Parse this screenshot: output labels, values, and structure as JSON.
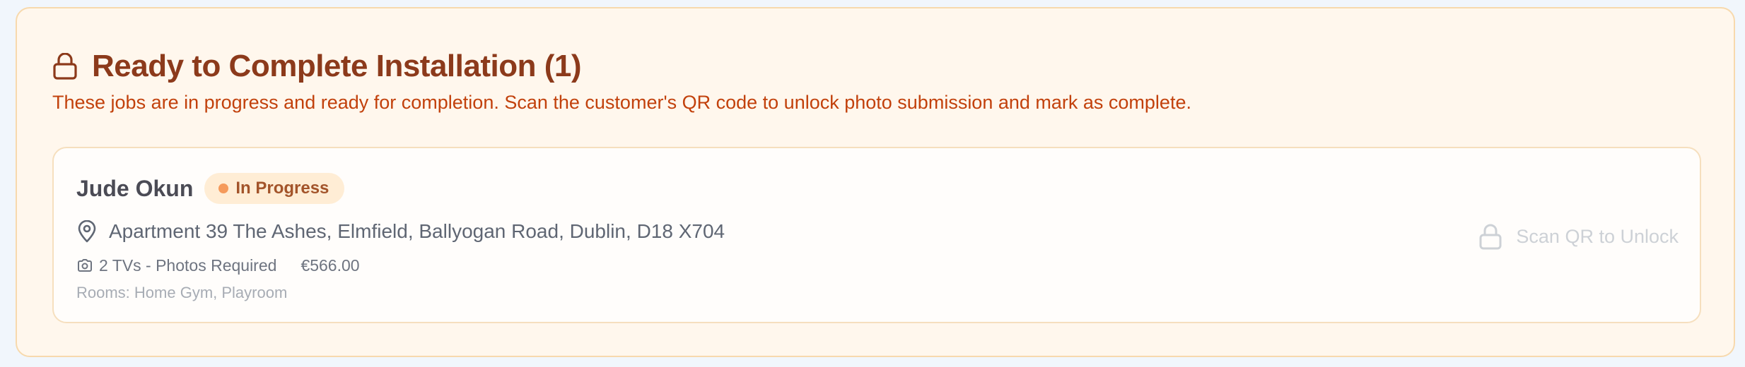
{
  "section": {
    "title": "Ready to Complete Installation (1)",
    "description": "These jobs are in progress and ready for completion. Scan the customer's QR code to unlock photo submission and mark as complete.",
    "icon": "lock-icon"
  },
  "jobs": [
    {
      "customer_name": "Jude Okun",
      "status": "In Progress",
      "address": "Apartment 39 The Ashes, Elmfield, Ballyogan Road, Dublin, D18 X704",
      "tv_info": "2 TVs - Photos Required",
      "price": "€566.00",
      "rooms": "Rooms: Home Gym, Playroom",
      "action_label": "Scan QR to Unlock"
    }
  ],
  "colors": {
    "panel_bg": "#fff7ed",
    "panel_border": "#f7d9ad",
    "title": "#8c3a1b",
    "description": "#c2410c",
    "badge_bg": "#ffedd5",
    "badge_dot": "#f59a5b",
    "disabled_action": "#cdd1d6"
  }
}
